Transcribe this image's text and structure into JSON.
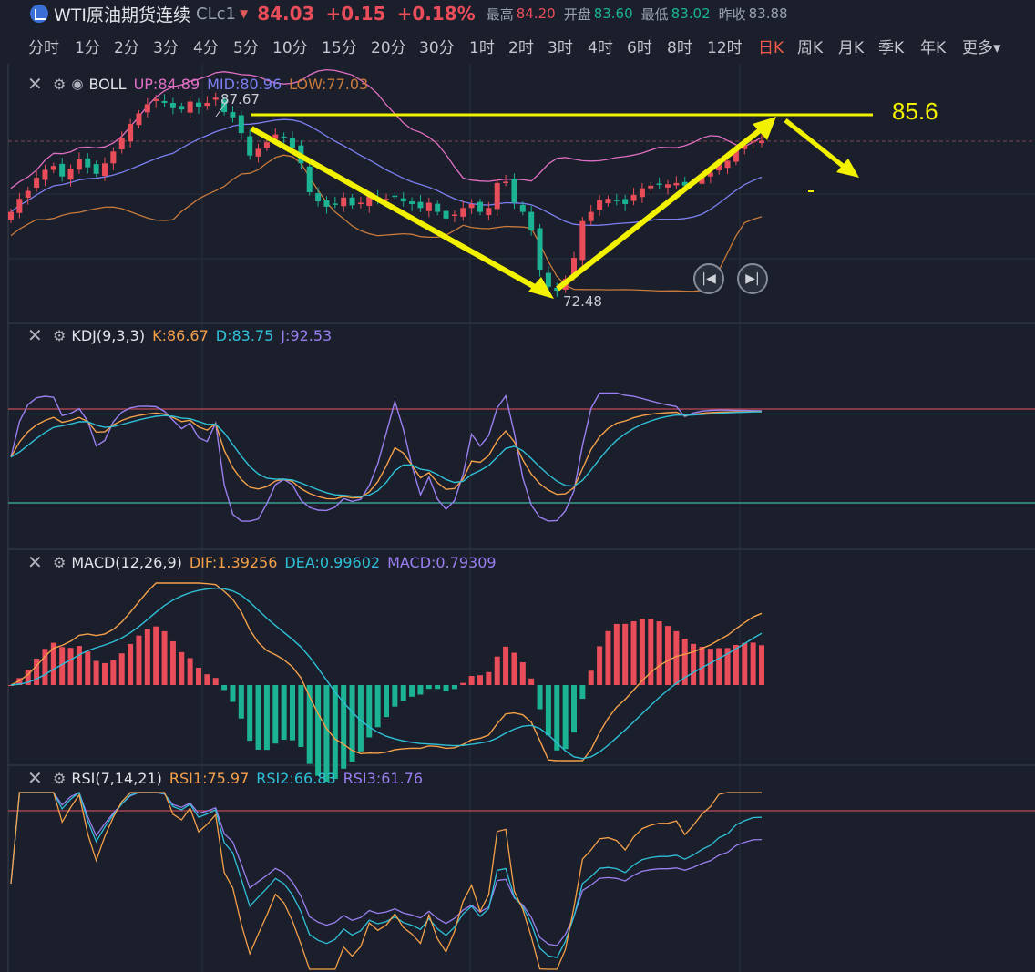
{
  "header": {
    "name": "WTI原油期货连续",
    "code": "CLc1",
    "price": "84.03",
    "change": "+0.15",
    "change_pct": "+0.18%",
    "high_label": "最高",
    "high": "84.20",
    "open_label": "开盘",
    "open": "83.60",
    "low_label": "最低",
    "low": "83.02",
    "prev_label": "昨收",
    "prev": "83.88"
  },
  "periods": [
    "分时",
    "1分",
    "2分",
    "3分",
    "4分",
    "5分",
    "10分",
    "15分",
    "20分",
    "30分",
    "1时",
    "2时",
    "3时",
    "4时",
    "6时",
    "8时",
    "12时",
    "日K",
    "周K",
    "月K",
    "季K",
    "年K",
    "更多"
  ],
  "active_period": "日K",
  "boll": {
    "name": "BOLL",
    "up": "UP:84.89",
    "mid": "MID:80.96",
    "low": "LOW:77.03",
    "high_mark": "87.67",
    "low_mark": "72.48",
    "target": "85.6"
  },
  "kdj": {
    "name": "KDJ(9,3,3)",
    "k": "K:86.67",
    "d": "D:83.75",
    "j": "J:92.53"
  },
  "macd": {
    "name": "MACD(12,26,9)",
    "dif": "DIF:1.39256",
    "dea": "DEA:0.99602",
    "macd": "MACD:0.79309"
  },
  "rsi": {
    "name": "RSI(7,14,21)",
    "r1": "RSI1:75.97",
    "r2": "RSI2:66.83",
    "r3": "RSI3:61.76"
  },
  "colors": {
    "up": "#ea4d5a",
    "down": "#1bb394",
    "bg": "#1b1f2b",
    "boll_up": "#e06fc4",
    "boll_mid": "#7b7ff0",
    "boll_low": "#c77a3c",
    "k": "#f4a04a",
    "d": "#2fc0d8",
    "j": "#9a7ff0",
    "annot": "#f2f200"
  },
  "chart_data": {
    "type": "candlestick",
    "closes": [
      78.6,
      79.6,
      80.2,
      81.2,
      81.8,
      82.1,
      81.3,
      81.9,
      82.6,
      82.0,
      81.5,
      82.3,
      83.2,
      84.2,
      85.3,
      86.1,
      86.8,
      87.2,
      86.9,
      86.5,
      86.4,
      87.0,
      86.6,
      86.9,
      87.3,
      86.2,
      85.8,
      84.6,
      82.9,
      83.4,
      83.9,
      84.5,
      84.2,
      83.5,
      82.3,
      80.1,
      79.4,
      79.0,
      79.2,
      79.7,
      79.1,
      79.3,
      79.8,
      79.5,
      79.6,
      79.8,
      79.4,
      79.2,
      78.9,
      79.3,
      78.6,
      78.1,
      78.4,
      78.9,
      79.2,
      78.6,
      78.9,
      80.8,
      80.9,
      79.3,
      78.6,
      77.2,
      74.2,
      72.9,
      72.6,
      73.5,
      75.1,
      77.9,
      78.6,
      79.5,
      79.6,
      79.5,
      79.2,
      79.9,
      80.4,
      80.6,
      80.7,
      80.7,
      80.8,
      80.6,
      80.9,
      81.3,
      81.6,
      82.2,
      82.5,
      83.3,
      83.7,
      84.0,
      84.03
    ]
  },
  "playback": {
    "prev": "prev-icon",
    "next": "next-icon"
  }
}
